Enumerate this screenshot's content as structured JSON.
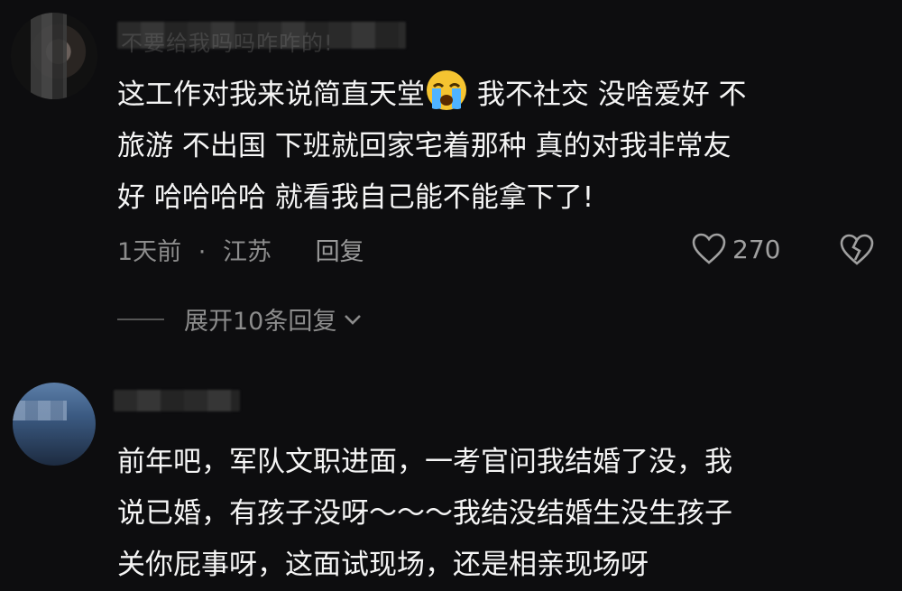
{
  "comment1": {
    "username": "不要给我吗吗咋咋的!",
    "lines": [
      "这工作对我来说简直天堂",
      " 我不社交 没啥爱好 不",
      "旅游 不出国 下班就回家宅着那种 真的对我非常友",
      "好 哈哈哈哈 就看我自己能不能拿下了!"
    ],
    "emoji_icon": "loudly-crying-face-icon",
    "time": "1天前",
    "location": "江苏",
    "separator": "·",
    "reply_label": "回复",
    "like_count": "270",
    "expand_label": "展开10条回复"
  },
  "comment2": {
    "lines": [
      "前年吧，军队文职进面，一考官问我结婚了没，我",
      "说已婚，有孩子没呀～～～我结没结婚生没生孩子",
      "关你屁事呀，这面试现场，还是相亲现场呀"
    ]
  },
  "colors": {
    "background": "#0d0d0f",
    "text": "#f5f5f5",
    "meta": "#8c8c8c",
    "emoji": "#f5c431"
  }
}
